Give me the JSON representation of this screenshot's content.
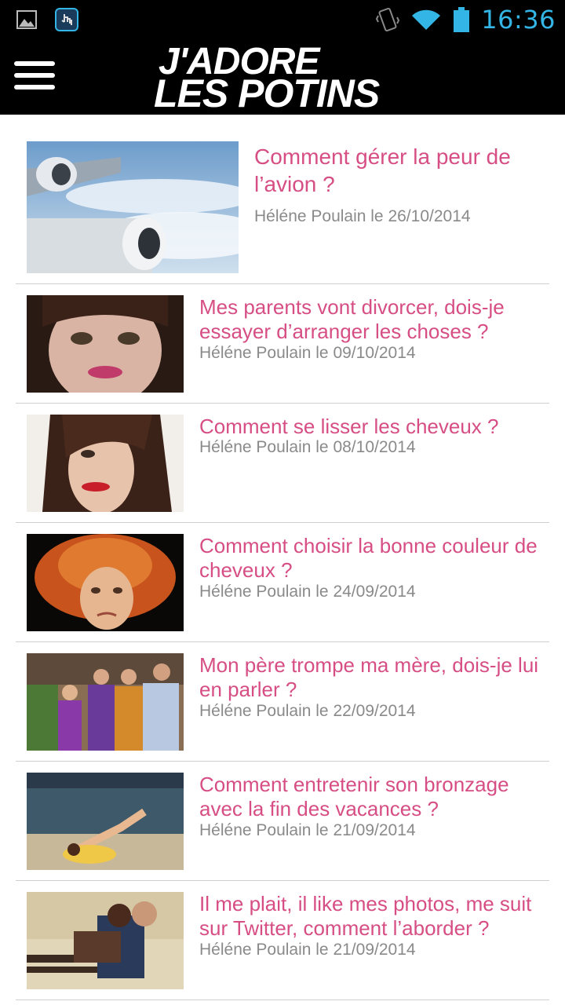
{
  "status_bar": {
    "time": "16:36",
    "icons": [
      "image-notification-icon",
      "touch-app-icon",
      "vibrate-icon",
      "wifi-icon",
      "battery-icon"
    ]
  },
  "app_bar": {
    "menu_icon": "hamburger-menu-icon",
    "logo_line1": "J'ADORE",
    "logo_line2": "LES POTINS"
  },
  "articles": [
    {
      "title": "Comment gérer la peur de l’avion ?",
      "meta": "Héléne Poulain le 26/10/2014",
      "image": "airplane-wing-clouds"
    },
    {
      "title": "Mes parents vont divorcer, dois-je essayer d’arranger les choses ?",
      "meta": "Héléne Poulain le 09/10/2014",
      "image": "crying-girl"
    },
    {
      "title": "Comment se lisser les cheveux ?",
      "meta": "Héléne Poulain le 08/10/2014",
      "image": "girl-straight-hair"
    },
    {
      "title": "Comment choisir la bonne couleur de cheveux ?",
      "meta": "Héléne Poulain le 24/09/2014",
      "image": "red-messy-hair"
    },
    {
      "title": "Mon père trompe ma mère, dois-je lui en parler ?",
      "meta": "Héléne Poulain le 22/09/2014",
      "image": "family-group"
    },
    {
      "title": "Comment entretenir son bronzage avec la fin des vacances ?",
      "meta": "Héléne Poulain le 21/09/2014",
      "image": "beach-sunbathing"
    },
    {
      "title": "Il me plait, il like mes photos, me suit sur Twitter, comment l’aborder ?",
      "meta": "Héléne Poulain le 21/09/2014",
      "image": "couple-on-bench"
    }
  ]
}
